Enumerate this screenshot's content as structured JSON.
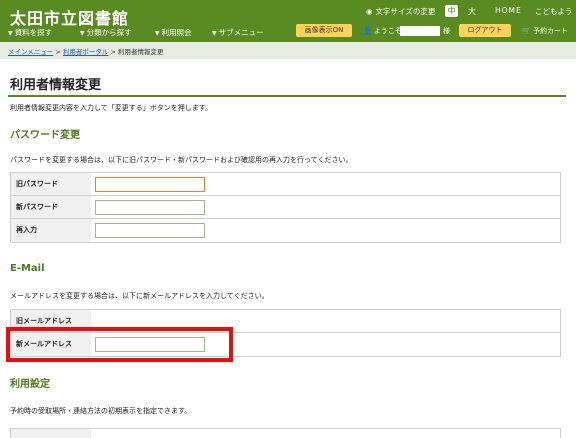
{
  "header": {
    "title": "太田市立図書館",
    "font_size_label": "文字サイズの変更",
    "font_size_mid": "中",
    "font_size_large": "大",
    "home": "HOME",
    "kids": "こどもよう",
    "nav": [
      "資料を探す",
      "分類から探す",
      "利用照会",
      "サブメニュー"
    ],
    "image_toggle": "画像表示ON",
    "welcome": "ようこそ",
    "suffix": "様",
    "logout": "ログアウト",
    "cart": "予約カート"
  },
  "breadcrumb": {
    "items": [
      "メインメニュー",
      "利用者ポータル",
      "利用者情報変更"
    ],
    "sep": ">"
  },
  "page": {
    "title": "利用者情報変更",
    "intro": "利用者情報変更内容を入力して「変更する」ボタンを押します。"
  },
  "password": {
    "heading": "パスワード変更",
    "text": "パスワードを変更する場合は、以下に旧パスワード・新パスワードおよび確認用の再入力を行ってください。",
    "old_label": "旧パスワード",
    "new_label": "新パスワード",
    "confirm_label": "再入力"
  },
  "email": {
    "heading": "E-Mail",
    "text": "メールアドレスを変更する場合は、以下に新メールアドレスを入力してください。",
    "old_label": "旧メールアドレス",
    "new_label": "新メールアドレス"
  },
  "usage": {
    "heading": "利用設定",
    "text": "予約時の受取場所・連絡方法の初期表示を指定できます。"
  },
  "colors": {
    "header_green": "#5a8a22",
    "accent_yellow": "#ffd35a",
    "highlight_red": "#e21010"
  }
}
